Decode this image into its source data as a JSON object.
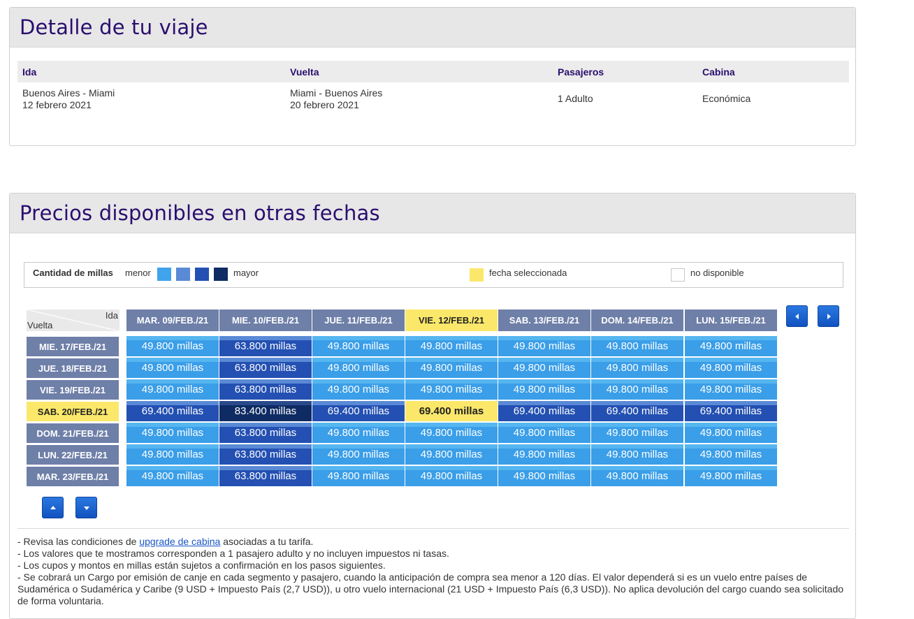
{
  "trip": {
    "title": "Detalle de tu viaje",
    "headers": {
      "ida": "Ida",
      "vuelta": "Vuelta",
      "pasajeros": "Pasajeros",
      "cabina": "Cabina"
    },
    "ida_route": "Buenos Aires - Miami",
    "ida_date": "12 febrero 2021",
    "vuelta_route": "Miami - Buenos Aires",
    "vuelta_date": "20 febrero 2021",
    "pasajeros": "1 Adulto",
    "cabina": "Económica"
  },
  "prices": {
    "title": "Precios disponibles en otras fechas",
    "legend": {
      "label": "Cantidad de millas",
      "menor": "menor",
      "mayor": "mayor",
      "selected": "fecha seleccionada",
      "unavailable": "no disponible",
      "scale_colors": [
        "#3fa4ec",
        "#5a8ad6",
        "#2350b2",
        "#0e2b63"
      ],
      "selected_color": "#fbe86a"
    },
    "corner": {
      "ida": "Ida",
      "vuelta": "Vuelta"
    },
    "columns": [
      "MAR. 09/FEB./21",
      "MIE. 10/FEB./21",
      "JUE. 11/FEB./21",
      "VIE. 12/FEB./21",
      "SAB. 13/FEB./21",
      "DOM. 14/FEB./21",
      "LUN. 15/FEB./21"
    ],
    "rows": [
      "MIE. 17/FEB./21",
      "JUE. 18/FEB./21",
      "VIE. 19/FEB./21",
      "SAB. 20/FEB./21",
      "DOM. 21/FEB./21",
      "LUN. 22/FEB./21",
      "MAR. 23/FEB./21"
    ],
    "selected_column": 3,
    "selected_row": 3,
    "cells": [
      [
        "49.800 millas",
        "63.800 millas",
        "49.800 millas",
        "49.800 millas",
        "49.800 millas",
        "49.800 millas",
        "49.800 millas"
      ],
      [
        "49.800 millas",
        "63.800 millas",
        "49.800 millas",
        "49.800 millas",
        "49.800 millas",
        "49.800 millas",
        "49.800 millas"
      ],
      [
        "49.800 millas",
        "63.800 millas",
        "49.800 millas",
        "49.800 millas",
        "49.800 millas",
        "49.800 millas",
        "49.800 millas"
      ],
      [
        "69.400 millas",
        "83.400 millas",
        "69.400 millas",
        "69.400 millas",
        "69.400 millas",
        "69.400 millas",
        "69.400 millas"
      ],
      [
        "49.800 millas",
        "63.800 millas",
        "49.800 millas",
        "49.800 millas",
        "49.800 millas",
        "49.800 millas",
        "49.800 millas"
      ],
      [
        "49.800 millas",
        "63.800 millas",
        "49.800 millas",
        "49.800 millas",
        "49.800 millas",
        "49.800 millas",
        "49.800 millas"
      ],
      [
        "49.800 millas",
        "63.800 millas",
        "49.800 millas",
        "49.800 millas",
        "49.800 millas",
        "49.800 millas",
        "49.800 millas"
      ]
    ],
    "cell_levels": [
      [
        1,
        3,
        1,
        1,
        1,
        1,
        1
      ],
      [
        1,
        3,
        1,
        1,
        1,
        1,
        1
      ],
      [
        1,
        3,
        1,
        1,
        1,
        1,
        1
      ],
      [
        3,
        4,
        3,
        0,
        3,
        3,
        3
      ],
      [
        1,
        3,
        1,
        1,
        1,
        1,
        1
      ],
      [
        1,
        3,
        1,
        1,
        1,
        1,
        1
      ],
      [
        1,
        3,
        1,
        1,
        1,
        1,
        1
      ]
    ],
    "nav_icons": {
      "prev": "arrow-left-icon",
      "next": "arrow-right-icon",
      "up": "arrow-up-icon",
      "down": "arrow-down-icon"
    }
  },
  "notes": {
    "line1_before": "- Revisa las condiciones de ",
    "line1_link": "upgrade de cabina",
    "line1_after": " asociadas a tu tarifa.",
    "line2": "- Los valores que te mostramos corresponden a 1 pasajero adulto y no incluyen impuestos ni tasas.",
    "line3": "- Los cupos y montos en millas están sujetos a confirmación en los pasos siguientes.",
    "line4": "- Se cobrará un Cargo por emisión de canje en cada segmento y pasajero, cuando la anticipación de compra sea menor a 120 días. El valor dependerá si es un vuelo entre países de Sudamérica o Sudamérica y Caribe (9 USD + Impuesto País (2,7 USD)), u otro vuelo internacional (21 USD + Impuesto País (6,3 USD)). No aplica devolución del cargo cuando sea solicitado de forma voluntaria."
  }
}
